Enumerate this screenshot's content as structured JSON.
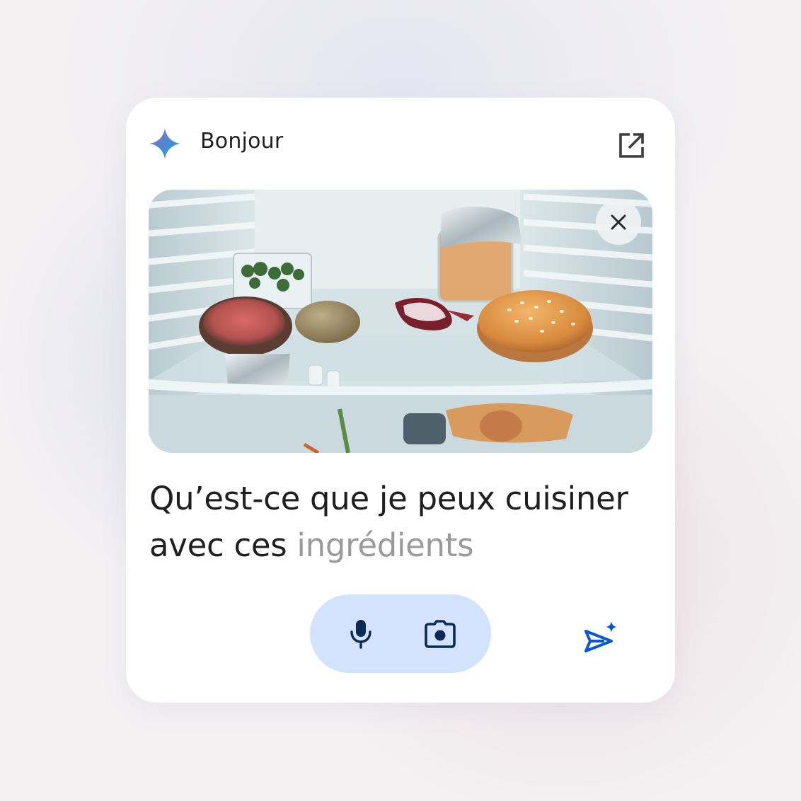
{
  "header": {
    "greeting": "Bonjour",
    "logo_icon": "gemini-sparkle-icon",
    "open_icon": "open-in-new-icon"
  },
  "image": {
    "description_icon": "camera-photo",
    "close_icon": "close-icon"
  },
  "prompt": {
    "text_main": "Qu’est-ce que je peux cuisiner avec ces ",
    "text_pending": "ingrédients"
  },
  "actions": {
    "mic_icon": "microphone-icon",
    "camera_icon": "camera-icon",
    "send_icon": "send-sparkle-icon"
  },
  "colors": {
    "accent": "#0b57d0",
    "pill_bg": "#d3e3fd",
    "text": "#1f1f1f",
    "muted_text": "#9a9a9a"
  }
}
